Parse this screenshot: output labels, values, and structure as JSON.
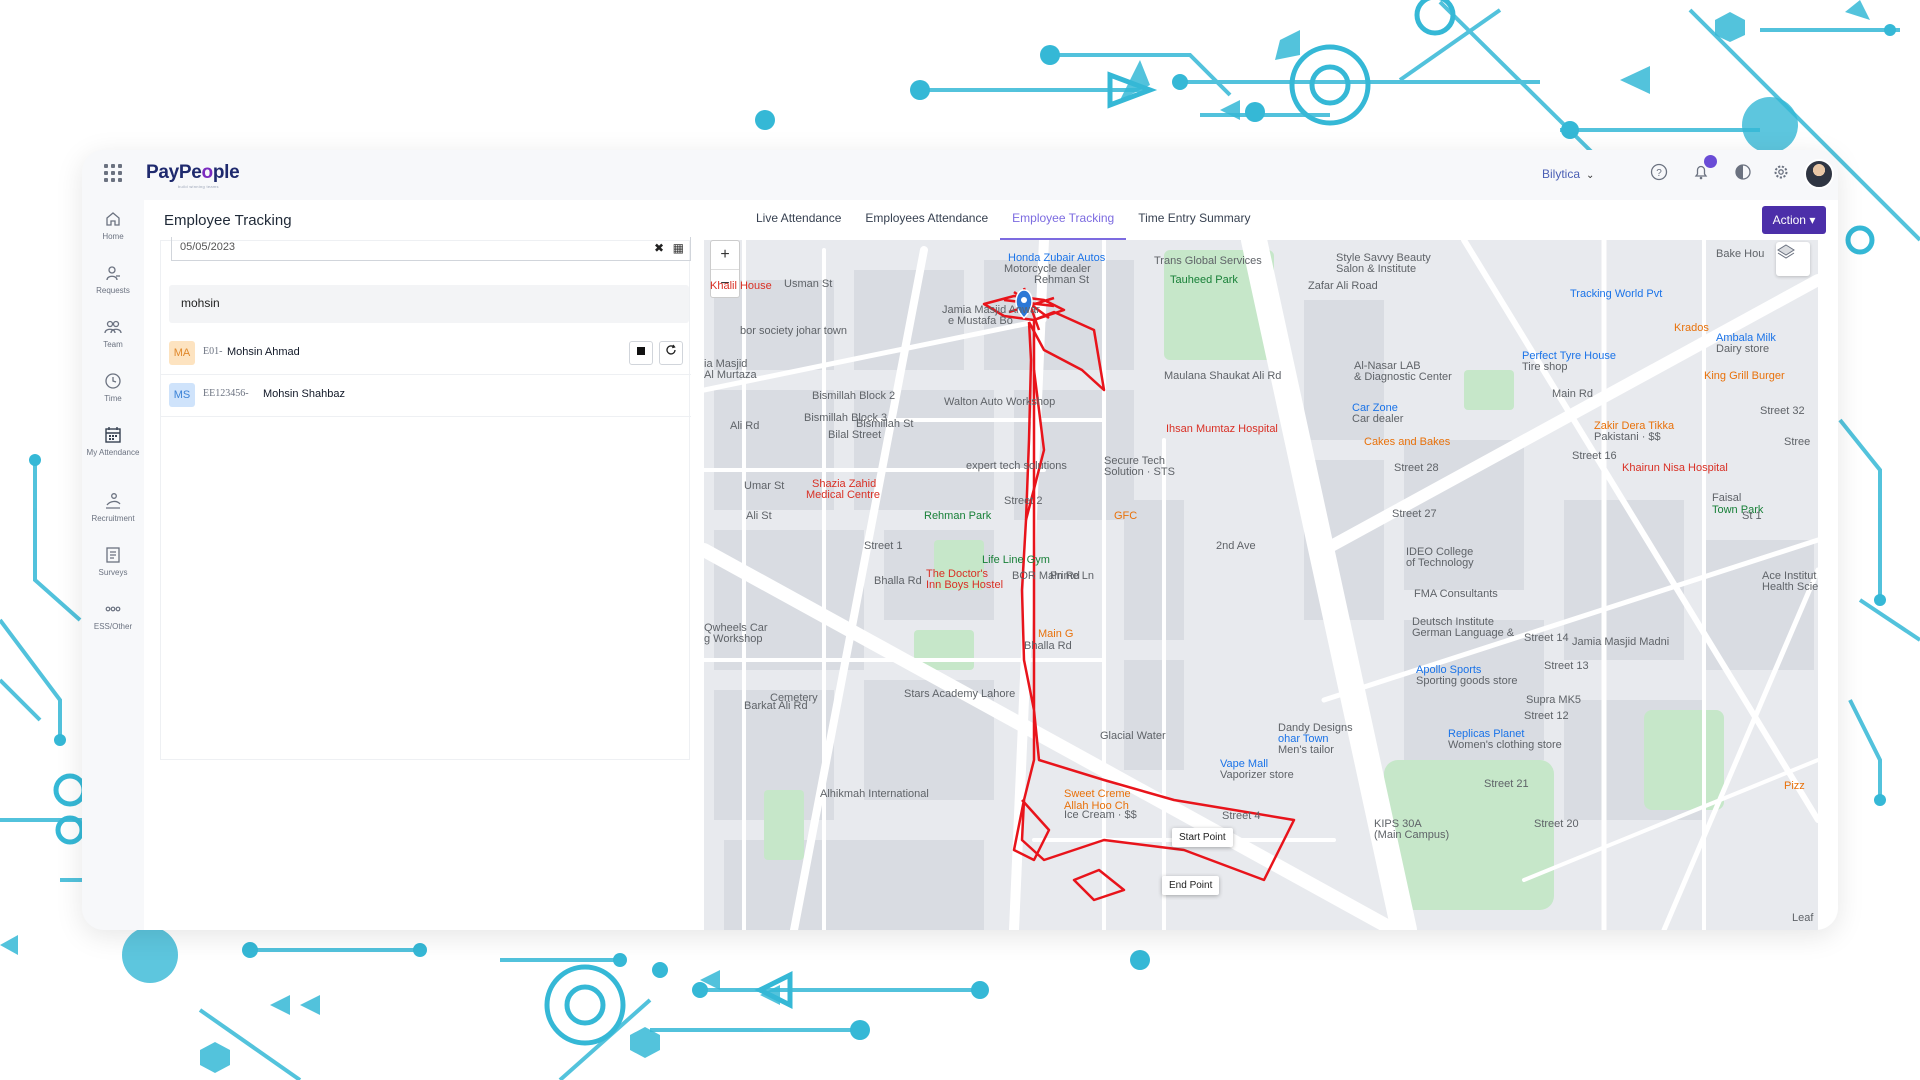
{
  "app": {
    "logo": "PayPe",
    "logo_o": "o",
    "logo_end": "ple",
    "tagline": "build winning teams",
    "company": "Bilytica",
    "notification_count": "",
    "icons": [
      "apps-grid-icon",
      "help-icon",
      "bell-icon",
      "history-icon",
      "gear-icon"
    ]
  },
  "sidebar": {
    "items": [
      {
        "label": "Home",
        "icon": "home-icon"
      },
      {
        "label": "Requests",
        "icon": "requests-icon"
      },
      {
        "label": "Team",
        "icon": "team-icon"
      },
      {
        "label": "Time",
        "icon": "clock-icon"
      },
      {
        "label": "My Attendance",
        "icon": "calendar-icon"
      },
      {
        "label": "Recruitment",
        "icon": "recruitment-icon"
      },
      {
        "label": "Surveys",
        "icon": "survey-icon"
      },
      {
        "label": "ESS/Other",
        "icon": "more-icon"
      }
    ]
  },
  "header": {
    "page_title": "Employee Tracking",
    "tabs": [
      {
        "label": "Live Attendance",
        "active": false
      },
      {
        "label": "Employees Attendance",
        "active": false
      },
      {
        "label": "Employee Tracking",
        "active": true
      },
      {
        "label": "Time Entry Summary",
        "active": false
      }
    ],
    "action_label": "Action",
    "action_caret": "▾"
  },
  "filters": {
    "date_value": "05/05/2023",
    "search_value": "mohsin"
  },
  "employees": [
    {
      "initials": "MA",
      "code": "E01-",
      "name": "Mohsin Ahmad",
      "badge_bg": "#fde3c0",
      "badge_fg": "#e0882b"
    },
    {
      "initials": "MS",
      "code": "EE123456-",
      "name": "Mohsin Shahbaz",
      "badge_bg": "#cfe3fb",
      "badge_fg": "#3b82d6"
    }
  ],
  "map": {
    "zoom_in": "+",
    "zoom_out": "−",
    "start_label": "Start Point",
    "end_label": "End Point",
    "route_color": "#e8141b",
    "labels": [
      {
        "text": "Honda Zubair Autos",
        "cls": "blue"
      },
      {
        "text": "Motorcycle dealer",
        "cls": ""
      },
      {
        "text": "Rehman St",
        "cls": ""
      },
      {
        "text": "Trans Global Services",
        "cls": ""
      },
      {
        "text": "Tauheed Park",
        "cls": "green"
      },
      {
        "text": "Style Savvy Beauty",
        "cls": ""
      },
      {
        "text": "Salon & Institute",
        "cls": ""
      },
      {
        "text": "Bake Hou",
        "cls": ""
      },
      {
        "text": "Tracking World Pvt",
        "cls": "blue"
      },
      {
        "text": "Krados",
        "cls": "orange"
      },
      {
        "text": "Ambala Milk",
        "cls": "blue"
      },
      {
        "text": "Dairy store",
        "cls": ""
      },
      {
        "text": "Perfect Tyre House",
        "cls": "blue"
      },
      {
        "text": "Tire shop",
        "cls": ""
      },
      {
        "text": "King Grill Burger",
        "cls": "orange"
      },
      {
        "text": "Khalil House",
        "cls": "red"
      },
      {
        "text": "bor society johar town",
        "cls": ""
      },
      {
        "text": "Jamia Masjid Anwar",
        "cls": ""
      },
      {
        "text": "e Mustafa Bo",
        "cls": ""
      },
      {
        "text": "ia Masjid",
        "cls": ""
      },
      {
        "text": "Al Murtaza",
        "cls": ""
      },
      {
        "text": "Bismillah Block 2",
        "cls": ""
      },
      {
        "text": "Bismillah Block 3",
        "cls": ""
      },
      {
        "text": "Bilal Street",
        "cls": ""
      },
      {
        "text": "Walton Auto Workshop",
        "cls": ""
      },
      {
        "text": "Al-Nasar LAB",
        "cls": ""
      },
      {
        "text": "& Diagnostic Center",
        "cls": ""
      },
      {
        "text": "Car Zone",
        "cls": "blue"
      },
      {
        "text": "Car dealer",
        "cls": ""
      },
      {
        "text": "Main Rd",
        "cls": ""
      },
      {
        "text": "Zakir Dera Tikka",
        "cls": "orange"
      },
      {
        "text": "Pakistani · $$",
        "cls": ""
      },
      {
        "text": "Ihsan Mumtaz Hospital",
        "cls": "red"
      },
      {
        "text": "Cakes and Bakes",
        "cls": "orange"
      },
      {
        "text": "Street 28",
        "cls": ""
      },
      {
        "text": "Khairun Nisa Hospital",
        "cls": "red"
      },
      {
        "text": "expert tech solutions",
        "cls": ""
      },
      {
        "text": "Secure Tech",
        "cls": ""
      },
      {
        "text": "Solution · STS",
        "cls": ""
      },
      {
        "text": "Shazia Zahid",
        "cls": "red"
      },
      {
        "text": "Medical Centre",
        "cls": "red"
      },
      {
        "text": "Street 2",
        "cls": ""
      },
      {
        "text": "GFC",
        "cls": "orange"
      },
      {
        "text": "Street 27",
        "cls": ""
      },
      {
        "text": "Faisal",
        "cls": ""
      },
      {
        "text": "Town Park",
        "cls": "green"
      },
      {
        "text": "Rehman Park",
        "cls": "green"
      },
      {
        "text": "Street 1",
        "cls": ""
      },
      {
        "text": "Life Line Gym",
        "cls": "green"
      },
      {
        "text": "IDEO College",
        "cls": ""
      },
      {
        "text": "of Technology",
        "cls": ""
      },
      {
        "text": "The Doctor's",
        "cls": "red"
      },
      {
        "text": "Inn Boys Hostel",
        "cls": "red"
      },
      {
        "text": "FMA Consultants",
        "cls": ""
      },
      {
        "text": "Ace Institut",
        "cls": ""
      },
      {
        "text": "Health Scie",
        "cls": ""
      },
      {
        "text": "Bhalla Rd",
        "cls": ""
      },
      {
        "text": "Deutsch Institute",
        "cls": ""
      },
      {
        "text": "German Language &",
        "cls": ""
      },
      {
        "text": "Jamia Masjid Madni",
        "cls": ""
      },
      {
        "text": "Qwheels Car",
        "cls": ""
      },
      {
        "text": "g Workshop",
        "cls": ""
      },
      {
        "text": "Main G",
        "cls": "orange"
      },
      {
        "text": "Bhalla Rd",
        "cls": ""
      },
      {
        "text": "Apollo Sports",
        "cls": "blue"
      },
      {
        "text": "Sporting goods store",
        "cls": ""
      },
      {
        "text": "Stars Academy Lahore",
        "cls": ""
      },
      {
        "text": "Supra MK5",
        "cls": ""
      },
      {
        "text": "Cemetery",
        "cls": ""
      },
      {
        "text": "Glacial Water",
        "cls": ""
      },
      {
        "text": "Dandy Designs",
        "cls": ""
      },
      {
        "text": "ohar Town",
        "cls": "blue"
      },
      {
        "text": "Men's tailor",
        "cls": ""
      },
      {
        "text": "Replicas Planet",
        "cls": "blue"
      },
      {
        "text": "Women's clothing store",
        "cls": ""
      },
      {
        "text": "Vape Mall",
        "cls": "blue"
      },
      {
        "text": "Vaporizer store",
        "cls": ""
      },
      {
        "text": "Street 21",
        "cls": ""
      },
      {
        "text": "Alhikmah International",
        "cls": ""
      },
      {
        "text": "Sweet Creme",
        "cls": "orange"
      },
      {
        "text": "Allah Hoo Ch",
        "cls": "orange"
      },
      {
        "text": "Ice Cream · $$",
        "cls": ""
      },
      {
        "text": "Street 4",
        "cls": ""
      },
      {
        "text": "KIPS 30A",
        "cls": ""
      },
      {
        "text": "(Main Campus)",
        "cls": ""
      },
      {
        "text": "Street 20",
        "cls": ""
      },
      {
        "text": "Street 12",
        "cls": ""
      },
      {
        "text": "Street 13",
        "cls": ""
      },
      {
        "text": "Street 14",
        "cls": ""
      },
      {
        "text": "Barkat Ali Rd",
        "cls": ""
      },
      {
        "text": "Ali Rd",
        "cls": ""
      },
      {
        "text": "BOR Main Rd",
        "cls": ""
      },
      {
        "text": "Prime Ln",
        "cls": ""
      },
      {
        "text": "2nd Ave",
        "cls": ""
      },
      {
        "text": "Maulana Shaukat Ali Rd",
        "cls": ""
      },
      {
        "text": "Zafar Ali Road",
        "cls": ""
      },
      {
        "text": "Usman St",
        "cls": ""
      },
      {
        "text": "Umar St",
        "cls": ""
      },
      {
        "text": "Ali St",
        "cls": ""
      },
      {
        "text": "Bismillah St",
        "cls": ""
      },
      {
        "text": "Street 32",
        "cls": ""
      },
      {
        "text": "Stree",
        "cls": ""
      },
      {
        "text": "St 1",
        "cls": ""
      },
      {
        "text": "Street 16",
        "cls": ""
      },
      {
        "text": "Pizz",
        "cls": "orange"
      },
      {
        "text": "Leaf",
        "cls": ""
      }
    ]
  }
}
